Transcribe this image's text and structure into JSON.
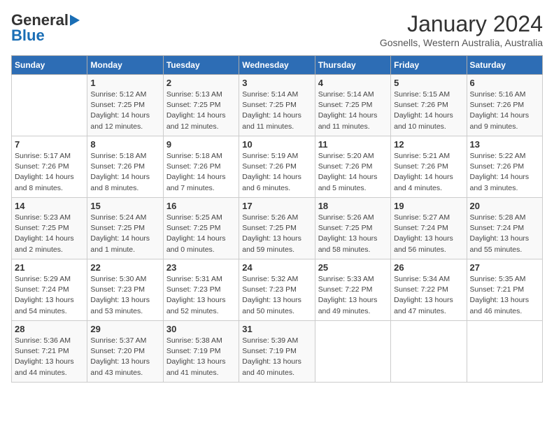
{
  "logo": {
    "line1": "General",
    "line2": "Blue"
  },
  "title": "January 2024",
  "subtitle": "Gosnells, Western Australia, Australia",
  "weekdays": [
    "Sunday",
    "Monday",
    "Tuesday",
    "Wednesday",
    "Thursday",
    "Friday",
    "Saturday"
  ],
  "weeks": [
    [
      {
        "day": "",
        "info": ""
      },
      {
        "day": "1",
        "info": "Sunrise: 5:12 AM\nSunset: 7:25 PM\nDaylight: 14 hours\nand 12 minutes."
      },
      {
        "day": "2",
        "info": "Sunrise: 5:13 AM\nSunset: 7:25 PM\nDaylight: 14 hours\nand 12 minutes."
      },
      {
        "day": "3",
        "info": "Sunrise: 5:14 AM\nSunset: 7:25 PM\nDaylight: 14 hours\nand 11 minutes."
      },
      {
        "day": "4",
        "info": "Sunrise: 5:14 AM\nSunset: 7:25 PM\nDaylight: 14 hours\nand 11 minutes."
      },
      {
        "day": "5",
        "info": "Sunrise: 5:15 AM\nSunset: 7:26 PM\nDaylight: 14 hours\nand 10 minutes."
      },
      {
        "day": "6",
        "info": "Sunrise: 5:16 AM\nSunset: 7:26 PM\nDaylight: 14 hours\nand 9 minutes."
      }
    ],
    [
      {
        "day": "7",
        "info": "Sunrise: 5:17 AM\nSunset: 7:26 PM\nDaylight: 14 hours\nand 8 minutes."
      },
      {
        "day": "8",
        "info": "Sunrise: 5:18 AM\nSunset: 7:26 PM\nDaylight: 14 hours\nand 8 minutes."
      },
      {
        "day": "9",
        "info": "Sunrise: 5:18 AM\nSunset: 7:26 PM\nDaylight: 14 hours\nand 7 minutes."
      },
      {
        "day": "10",
        "info": "Sunrise: 5:19 AM\nSunset: 7:26 PM\nDaylight: 14 hours\nand 6 minutes."
      },
      {
        "day": "11",
        "info": "Sunrise: 5:20 AM\nSunset: 7:26 PM\nDaylight: 14 hours\nand 5 minutes."
      },
      {
        "day": "12",
        "info": "Sunrise: 5:21 AM\nSunset: 7:26 PM\nDaylight: 14 hours\nand 4 minutes."
      },
      {
        "day": "13",
        "info": "Sunrise: 5:22 AM\nSunset: 7:26 PM\nDaylight: 14 hours\nand 3 minutes."
      }
    ],
    [
      {
        "day": "14",
        "info": "Sunrise: 5:23 AM\nSunset: 7:25 PM\nDaylight: 14 hours\nand 2 minutes."
      },
      {
        "day": "15",
        "info": "Sunrise: 5:24 AM\nSunset: 7:25 PM\nDaylight: 14 hours\nand 1 minute."
      },
      {
        "day": "16",
        "info": "Sunrise: 5:25 AM\nSunset: 7:25 PM\nDaylight: 14 hours\nand 0 minutes."
      },
      {
        "day": "17",
        "info": "Sunrise: 5:26 AM\nSunset: 7:25 PM\nDaylight: 13 hours\nand 59 minutes."
      },
      {
        "day": "18",
        "info": "Sunrise: 5:26 AM\nSunset: 7:25 PM\nDaylight: 13 hours\nand 58 minutes."
      },
      {
        "day": "19",
        "info": "Sunrise: 5:27 AM\nSunset: 7:24 PM\nDaylight: 13 hours\nand 56 minutes."
      },
      {
        "day": "20",
        "info": "Sunrise: 5:28 AM\nSunset: 7:24 PM\nDaylight: 13 hours\nand 55 minutes."
      }
    ],
    [
      {
        "day": "21",
        "info": "Sunrise: 5:29 AM\nSunset: 7:24 PM\nDaylight: 13 hours\nand 54 minutes."
      },
      {
        "day": "22",
        "info": "Sunrise: 5:30 AM\nSunset: 7:23 PM\nDaylight: 13 hours\nand 53 minutes."
      },
      {
        "day": "23",
        "info": "Sunrise: 5:31 AM\nSunset: 7:23 PM\nDaylight: 13 hours\nand 52 minutes."
      },
      {
        "day": "24",
        "info": "Sunrise: 5:32 AM\nSunset: 7:23 PM\nDaylight: 13 hours\nand 50 minutes."
      },
      {
        "day": "25",
        "info": "Sunrise: 5:33 AM\nSunset: 7:22 PM\nDaylight: 13 hours\nand 49 minutes."
      },
      {
        "day": "26",
        "info": "Sunrise: 5:34 AM\nSunset: 7:22 PM\nDaylight: 13 hours\nand 47 minutes."
      },
      {
        "day": "27",
        "info": "Sunrise: 5:35 AM\nSunset: 7:21 PM\nDaylight: 13 hours\nand 46 minutes."
      }
    ],
    [
      {
        "day": "28",
        "info": "Sunrise: 5:36 AM\nSunset: 7:21 PM\nDaylight: 13 hours\nand 44 minutes."
      },
      {
        "day": "29",
        "info": "Sunrise: 5:37 AM\nSunset: 7:20 PM\nDaylight: 13 hours\nand 43 minutes."
      },
      {
        "day": "30",
        "info": "Sunrise: 5:38 AM\nSunset: 7:19 PM\nDaylight: 13 hours\nand 41 minutes."
      },
      {
        "day": "31",
        "info": "Sunrise: 5:39 AM\nSunset: 7:19 PM\nDaylight: 13 hours\nand 40 minutes."
      },
      {
        "day": "",
        "info": ""
      },
      {
        "day": "",
        "info": ""
      },
      {
        "day": "",
        "info": ""
      }
    ]
  ]
}
